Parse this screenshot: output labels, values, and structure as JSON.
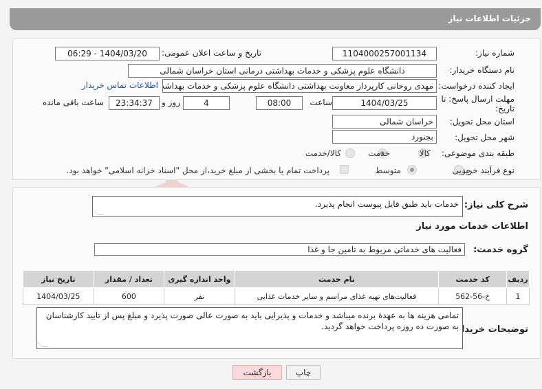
{
  "header": {
    "title": "جزئیات اطلاعات نیاز"
  },
  "fields": {
    "need_number_label": "شماره نیاز:",
    "need_number": "1104000257001134",
    "announce_label": "تاریخ و ساعت اعلان عمومی:",
    "announce_value": "1404/03/20 - 06:29",
    "buyer_org_label": "نام دستگاه خریدار:",
    "buyer_org": "دانشگاه علوم پزشکی و خدمات بهداشتی درمانی استان خراسان شمالی",
    "creator_label": "ایجاد کننده درخواست:",
    "creator": "مهدی روحانی کارپرداز معاونت بهداشتی دانشگاه علوم پزشکی و خدمات بهداشت",
    "contact_link": "اطلاعات تماس خریدار",
    "deadline_label_1": "مهلت ارسال پاسخ: تا",
    "deadline_label_2": "تاریخ:",
    "deadline_date": "1404/03/25",
    "time_label": "ساعت",
    "deadline_time": "08:00",
    "days": "4",
    "days_label": "روز و",
    "remaining": "23:34:37",
    "remaining_label": "ساعت باقی مانده",
    "province_label": "استان محل تحویل:",
    "province": "خراسان شمالی",
    "city_label": "شهر محل تحویل:",
    "city": "بجنورد",
    "category_label": "طبقه بندی موضوعی:",
    "category_options": [
      "کالا",
      "خدمت",
      "کالا/خدمت"
    ],
    "category_selected": "خدمت",
    "process_label": "نوع فرآیند خرید :",
    "process_options": [
      "جزیی",
      "متوسط"
    ],
    "process_selected": "متوسط",
    "payment_note": "پرداخت تمام یا بخشی از مبلغ خرید،از محل \"اسناد خزانه اسلامی\" خواهد بود."
  },
  "description": {
    "label": "شرح کلی نیاز:",
    "text": "خدمات باید طبق فایل پیوست انجام پذیرد."
  },
  "services": {
    "section_title": "اطلاعات خدمات مورد نیاز",
    "group_label": "گروه خدمت:",
    "group_value": "فعالیت های خدماتی مربوط به تامین جا و غذا",
    "columns": [
      "ردیف",
      "کد خدمت",
      "نام خدمت",
      "واحد اندازه گیری",
      "تعداد / مقدار",
      "تاریخ نیاز"
    ],
    "rows": [
      [
        "1",
        "خ-56-562",
        "فعالیت‌های تهیه غذای مراسم و سایر خدمات غذایی",
        "نفر",
        "600",
        "1404/03/25"
      ]
    ]
  },
  "buyer_notes": {
    "label": "توضیحات خریدار:",
    "text": "تمامی هزینه ها  به عهدهٔ برنده میباشد و خدمات و پذیرایی باید به صورت عالی صورت پذیرد و مبلغ پس از تایید کارشناسان به صورت ده روزه پرداخت خواهد گردید."
  },
  "buttons": {
    "print": "چاپ",
    "back": "بازگشت"
  },
  "watermark": {
    "text": "AriaTender.neT"
  },
  "colors": {
    "header_bg": "#9a9a9a",
    "link": "#1a52a5",
    "back_button_bg": "#f9d9d9",
    "print_button_bg": "#f2f2f2"
  }
}
